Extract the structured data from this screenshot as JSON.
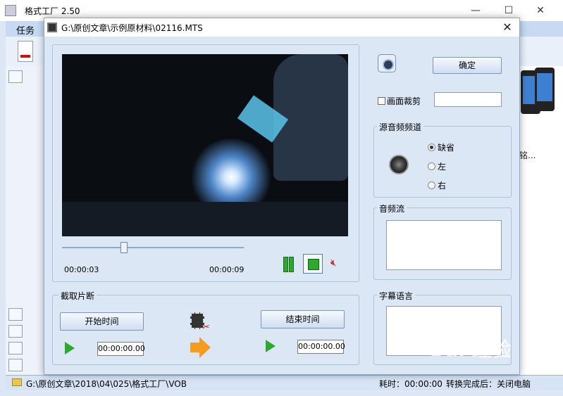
{
  "app": {
    "title": "格式工厂 2.50",
    "menu_tasks": "任务",
    "status_path": "G:\\原创文章\\2018\\04\\025\\格式工厂\\VOB",
    "status_time": "耗时：00:00:00",
    "status_after": "转换完成后：关闭电脑",
    "truncated_text": "铭..."
  },
  "dialog": {
    "title": "G:\\原创文章\\示例原材料\\02116.MTS",
    "current_time": "00:00:03",
    "total_time": "00:00:09",
    "clip_group_label": "截取片断",
    "start_time_button": "开始时间",
    "end_time_button": "结束时间",
    "start_time_value": "00:00:00.00",
    "end_time_value": "00:00:00.00",
    "ok_button": "确定",
    "crop_label": "画面裁剪",
    "source_audio_label": "源音频频道",
    "audio_options": [
      "缺省",
      "左",
      "右"
    ],
    "audio_selected": "缺省",
    "audio_stream_label": "音频流",
    "subtitle_language_label": "字幕语言"
  },
  "watermark": "Bai 经验",
  "colors": {
    "accent_green": "#2ea82e",
    "dialog_bg": "#dce7f6"
  }
}
